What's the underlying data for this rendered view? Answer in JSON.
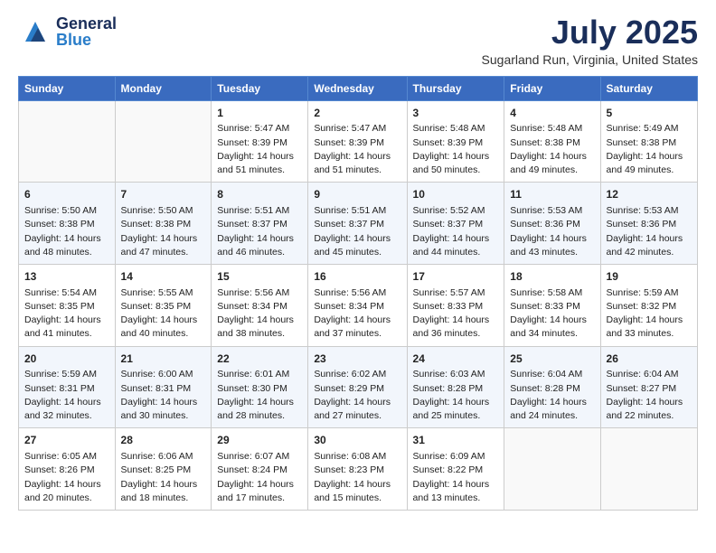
{
  "logo": {
    "general": "General",
    "blue": "Blue"
  },
  "title": "July 2025",
  "location": "Sugarland Run, Virginia, United States",
  "days_of_week": [
    "Sunday",
    "Monday",
    "Tuesday",
    "Wednesday",
    "Thursday",
    "Friday",
    "Saturday"
  ],
  "weeks": [
    [
      {
        "day": "",
        "info": ""
      },
      {
        "day": "",
        "info": ""
      },
      {
        "day": "1",
        "info": "Sunrise: 5:47 AM\nSunset: 8:39 PM\nDaylight: 14 hours and 51 minutes."
      },
      {
        "day": "2",
        "info": "Sunrise: 5:47 AM\nSunset: 8:39 PM\nDaylight: 14 hours and 51 minutes."
      },
      {
        "day": "3",
        "info": "Sunrise: 5:48 AM\nSunset: 8:39 PM\nDaylight: 14 hours and 50 minutes."
      },
      {
        "day": "4",
        "info": "Sunrise: 5:48 AM\nSunset: 8:38 PM\nDaylight: 14 hours and 49 minutes."
      },
      {
        "day": "5",
        "info": "Sunrise: 5:49 AM\nSunset: 8:38 PM\nDaylight: 14 hours and 49 minutes."
      }
    ],
    [
      {
        "day": "6",
        "info": "Sunrise: 5:50 AM\nSunset: 8:38 PM\nDaylight: 14 hours and 48 minutes."
      },
      {
        "day": "7",
        "info": "Sunrise: 5:50 AM\nSunset: 8:38 PM\nDaylight: 14 hours and 47 minutes."
      },
      {
        "day": "8",
        "info": "Sunrise: 5:51 AM\nSunset: 8:37 PM\nDaylight: 14 hours and 46 minutes."
      },
      {
        "day": "9",
        "info": "Sunrise: 5:51 AM\nSunset: 8:37 PM\nDaylight: 14 hours and 45 minutes."
      },
      {
        "day": "10",
        "info": "Sunrise: 5:52 AM\nSunset: 8:37 PM\nDaylight: 14 hours and 44 minutes."
      },
      {
        "day": "11",
        "info": "Sunrise: 5:53 AM\nSunset: 8:36 PM\nDaylight: 14 hours and 43 minutes."
      },
      {
        "day": "12",
        "info": "Sunrise: 5:53 AM\nSunset: 8:36 PM\nDaylight: 14 hours and 42 minutes."
      }
    ],
    [
      {
        "day": "13",
        "info": "Sunrise: 5:54 AM\nSunset: 8:35 PM\nDaylight: 14 hours and 41 minutes."
      },
      {
        "day": "14",
        "info": "Sunrise: 5:55 AM\nSunset: 8:35 PM\nDaylight: 14 hours and 40 minutes."
      },
      {
        "day": "15",
        "info": "Sunrise: 5:56 AM\nSunset: 8:34 PM\nDaylight: 14 hours and 38 minutes."
      },
      {
        "day": "16",
        "info": "Sunrise: 5:56 AM\nSunset: 8:34 PM\nDaylight: 14 hours and 37 minutes."
      },
      {
        "day": "17",
        "info": "Sunrise: 5:57 AM\nSunset: 8:33 PM\nDaylight: 14 hours and 36 minutes."
      },
      {
        "day": "18",
        "info": "Sunrise: 5:58 AM\nSunset: 8:33 PM\nDaylight: 14 hours and 34 minutes."
      },
      {
        "day": "19",
        "info": "Sunrise: 5:59 AM\nSunset: 8:32 PM\nDaylight: 14 hours and 33 minutes."
      }
    ],
    [
      {
        "day": "20",
        "info": "Sunrise: 5:59 AM\nSunset: 8:31 PM\nDaylight: 14 hours and 32 minutes."
      },
      {
        "day": "21",
        "info": "Sunrise: 6:00 AM\nSunset: 8:31 PM\nDaylight: 14 hours and 30 minutes."
      },
      {
        "day": "22",
        "info": "Sunrise: 6:01 AM\nSunset: 8:30 PM\nDaylight: 14 hours and 28 minutes."
      },
      {
        "day": "23",
        "info": "Sunrise: 6:02 AM\nSunset: 8:29 PM\nDaylight: 14 hours and 27 minutes."
      },
      {
        "day": "24",
        "info": "Sunrise: 6:03 AM\nSunset: 8:28 PM\nDaylight: 14 hours and 25 minutes."
      },
      {
        "day": "25",
        "info": "Sunrise: 6:04 AM\nSunset: 8:28 PM\nDaylight: 14 hours and 24 minutes."
      },
      {
        "day": "26",
        "info": "Sunrise: 6:04 AM\nSunset: 8:27 PM\nDaylight: 14 hours and 22 minutes."
      }
    ],
    [
      {
        "day": "27",
        "info": "Sunrise: 6:05 AM\nSunset: 8:26 PM\nDaylight: 14 hours and 20 minutes."
      },
      {
        "day": "28",
        "info": "Sunrise: 6:06 AM\nSunset: 8:25 PM\nDaylight: 14 hours and 18 minutes."
      },
      {
        "day": "29",
        "info": "Sunrise: 6:07 AM\nSunset: 8:24 PM\nDaylight: 14 hours and 17 minutes."
      },
      {
        "day": "30",
        "info": "Sunrise: 6:08 AM\nSunset: 8:23 PM\nDaylight: 14 hours and 15 minutes."
      },
      {
        "day": "31",
        "info": "Sunrise: 6:09 AM\nSunset: 8:22 PM\nDaylight: 14 hours and 13 minutes."
      },
      {
        "day": "",
        "info": ""
      },
      {
        "day": "",
        "info": ""
      }
    ]
  ]
}
